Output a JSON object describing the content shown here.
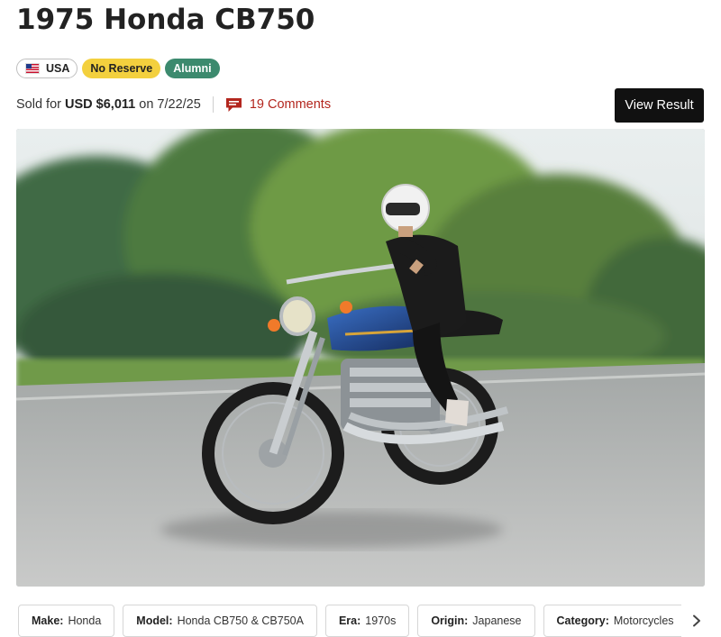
{
  "listing": {
    "title": "1975 Honda CB750",
    "badges": {
      "country": "USA",
      "country_flag_icon": "us-flag-icon",
      "reserve": "No Reserve",
      "alumni": "Alumni"
    },
    "sold": {
      "prefix": "Sold for",
      "price": "USD $6,011",
      "on": "on",
      "date": "7/22/25"
    },
    "comments": {
      "label": "19 Comments",
      "icon": "comment-icon",
      "color": "#b3261e"
    },
    "view_result_label": "View Result",
    "photo": {
      "subject": "rider-on-blue-honda-cb750-motorcycle"
    },
    "chips": [
      {
        "key": "Make:",
        "value": "Honda"
      },
      {
        "key": "Model:",
        "value": "Honda CB750 & CB750A"
      },
      {
        "key": "Era:",
        "value": "1970s"
      },
      {
        "key": "Origin:",
        "value": "Japanese"
      },
      {
        "key": "Category:",
        "value": "Motorcycles"
      }
    ],
    "chips_next_icon": "chevron-right-icon"
  },
  "colors": {
    "reserve_badge": "#f3d03e",
    "alumni_badge": "#3c8a6e",
    "button": "#111111"
  }
}
